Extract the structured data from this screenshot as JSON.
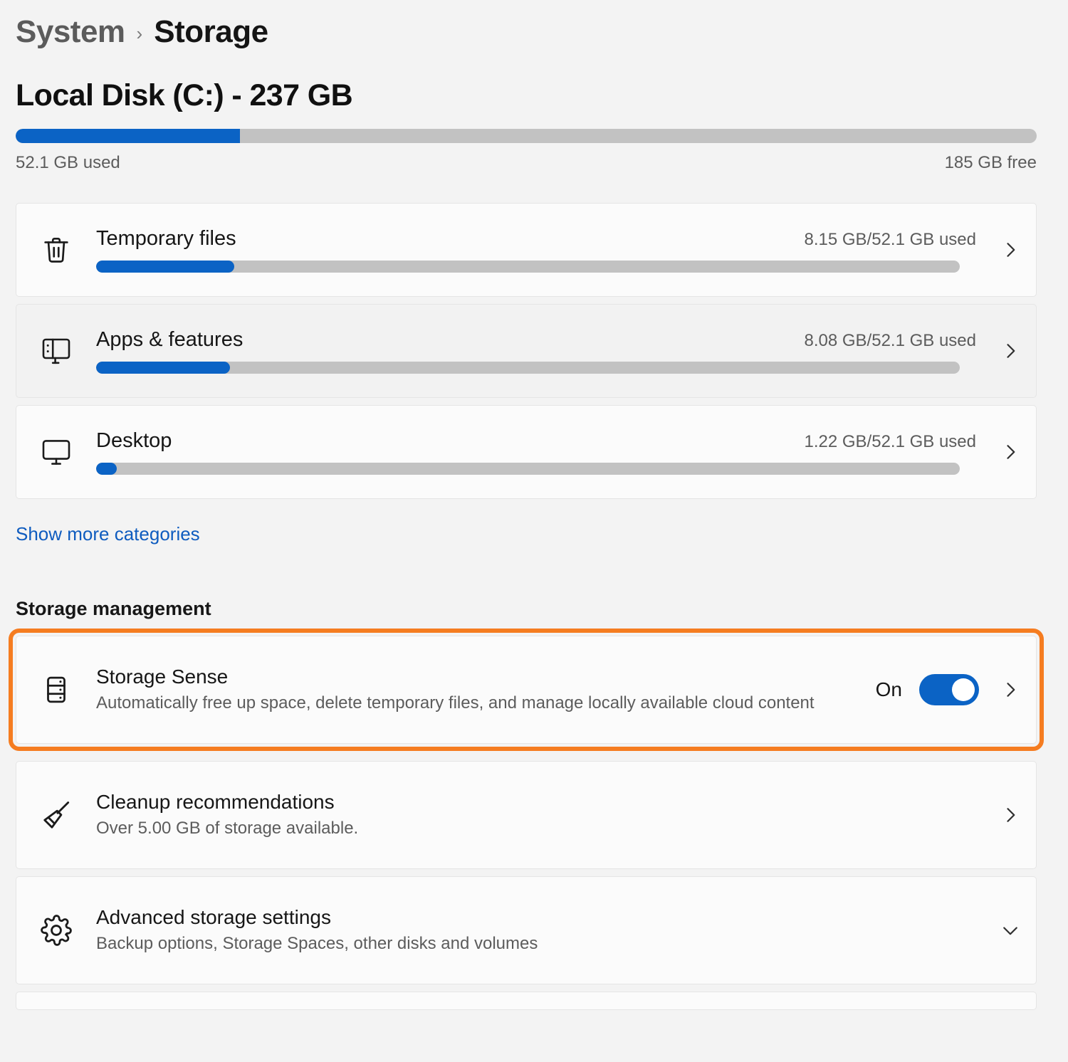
{
  "breadcrumb": {
    "parent": "System",
    "separator": "›",
    "current": "Storage"
  },
  "disk": {
    "title": "Local Disk (C:) - 237 GB",
    "used_label": "52.1 GB used",
    "free_label": "185 GB free",
    "used_percent": 22,
    "total_gb": 237,
    "used_gb": 52.1,
    "free_gb": 185,
    "fill_color": "#0b63c5",
    "track_color": "#c2c2c2"
  },
  "categories": [
    {
      "icon": "trash-icon",
      "name": "Temporary files",
      "usage": "8.15 GB/52.1 GB used",
      "percent": 16,
      "chevron": "chevron-right-icon",
      "hovered": false
    },
    {
      "icon": "apps-features-icon",
      "name": "Apps & features",
      "usage": "8.08 GB/52.1 GB used",
      "percent": 15.5,
      "chevron": "chevron-right-icon",
      "hovered": true
    },
    {
      "icon": "monitor-icon",
      "name": "Desktop",
      "usage": "1.22 GB/52.1 GB used",
      "percent": 2.4,
      "chevron": "chevron-right-icon",
      "hovered": false
    }
  ],
  "show_more_link": "Show more categories",
  "storage_management": {
    "heading": "Storage management",
    "highlight_color": "#f57c20",
    "items": [
      {
        "icon": "server-rack-icon",
        "title": "Storage Sense",
        "description": "Automatically free up space, delete temporary files, and manage locally available cloud content",
        "toggle_label": "On",
        "toggle_on": true,
        "chevron": "chevron-right-icon",
        "highlighted": true
      },
      {
        "icon": "broom-icon",
        "title": "Cleanup recommendations",
        "description": "Over 5.00 GB of storage available.",
        "chevron": "chevron-right-icon",
        "highlighted": false
      },
      {
        "icon": "gear-icon",
        "title": "Advanced storage settings",
        "description": "Backup options, Storage Spaces, other disks and volumes",
        "chevron": "chevron-down-icon",
        "highlighted": false
      }
    ]
  }
}
